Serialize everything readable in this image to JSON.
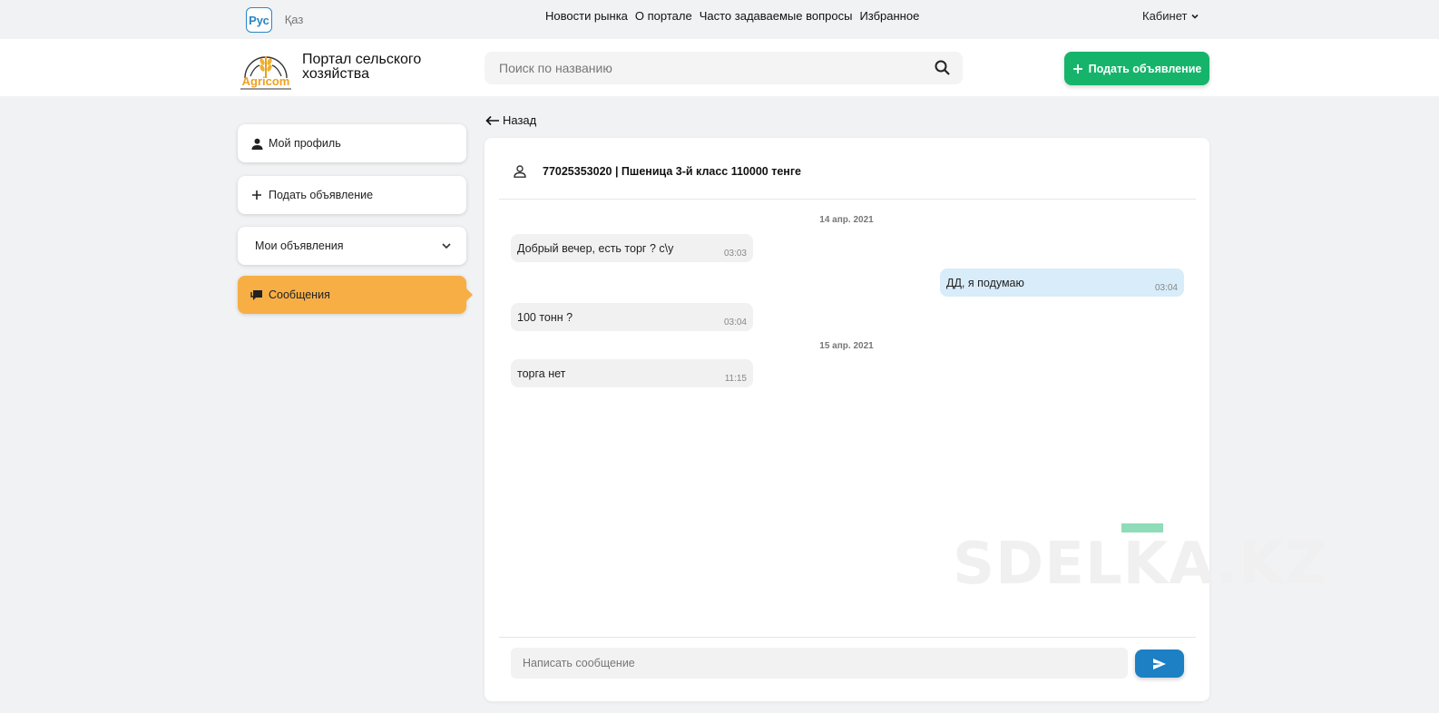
{
  "top": {
    "lang_active": "Рус",
    "lang_other": "Қаз",
    "nav": [
      "Новости рынка",
      "О портале",
      "Часто задаваемые вопросы",
      "Избранное"
    ],
    "cabinet": "Кабинет"
  },
  "header": {
    "logo_text": "Agricom",
    "brand_line1": "Портал сельского",
    "brand_line2": "хозяйства",
    "search_placeholder": "Поиск по названию",
    "post_button": "Подать объявление"
  },
  "sidebar": {
    "items": [
      {
        "label": "Мой профиль",
        "icon": "person-icon"
      },
      {
        "label": "Подать объявление",
        "icon": "plus-icon"
      },
      {
        "label": "Мои объявления",
        "icon": "chevron-down-icon"
      },
      {
        "label": "Сообщения",
        "icon": "chat-icon"
      }
    ]
  },
  "back_label": "Назад",
  "chat": {
    "title": "77025353020 | Пшеница 3-й класс 110000 тенге",
    "groups": [
      {
        "date": "14 апр. 2021",
        "messages": [
          {
            "text": "Добрый вечер, есть торг ? с\\у",
            "time": "03:03",
            "dir": "in"
          },
          {
            "text": "ДД, я подумаю",
            "time": "03:04",
            "dir": "out"
          },
          {
            "text": "100 тонн ?",
            "time": "03:04",
            "dir": "in"
          }
        ]
      },
      {
        "date": "15 апр. 2021",
        "messages": [
          {
            "text": "торга нет",
            "time": "11:15",
            "dir": "in"
          }
        ]
      }
    ],
    "input_placeholder": "Написать сообщение"
  },
  "watermark": "SDELKA.KZ",
  "colors": {
    "accent_green": "#16b46b",
    "active_orange": "#f7ae45",
    "send_blue": "#1d7fc4",
    "out_bubble": "#d8ecfa"
  }
}
